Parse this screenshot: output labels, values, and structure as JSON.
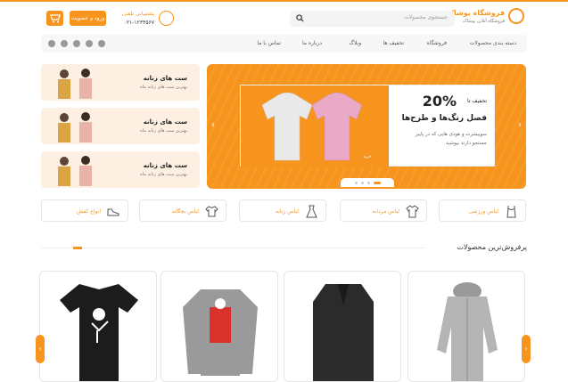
{
  "header": {
    "logo_title": "فروشگاه پوشاک",
    "logo_subtitle": "فروشگاه آنلاین پوشاک",
    "search_placeholder": "جستجوی محصولات",
    "support_label": "پشتیبانی تلفنی",
    "support_phone": "۰۲۱-۱۲۳۴۵۶۷",
    "login_label": "ورود و عضویت"
  },
  "nav": {
    "items": [
      "دسته بندی محصولات",
      "فروشگاه",
      "تخفیف ها",
      "وبلاگ",
      "درباره ما",
      "تماس با ما"
    ]
  },
  "side_banners": [
    {
      "title": "ست های زنانه",
      "subtitle": "بهترین ست های زنانه ماه"
    },
    {
      "title": "ست های زنانه",
      "subtitle": "بهترین ست های زنانه ماه"
    },
    {
      "title": "ست های زنانه",
      "subtitle": "بهترین ست های زنانه ماه"
    }
  ],
  "hero": {
    "discount_value": "20%",
    "discount_prefix": "تخفیف تا",
    "title": "فصل رنگ‌ها و طرح‌ها",
    "desc_line1": "سوییشرت و هودی هایی که در پاییز",
    "desc_line2": "جستجو دارند بپوشید",
    "button": "خرید"
  },
  "categories": [
    "لباس ورزشی",
    "لباس مردانه",
    "لباس زنانه",
    "لباس بچگانه",
    "انواع کفش"
  ],
  "section": {
    "title": "پرفروش‌ترین محصولات"
  },
  "colors": {
    "accent": "#f7941d"
  }
}
